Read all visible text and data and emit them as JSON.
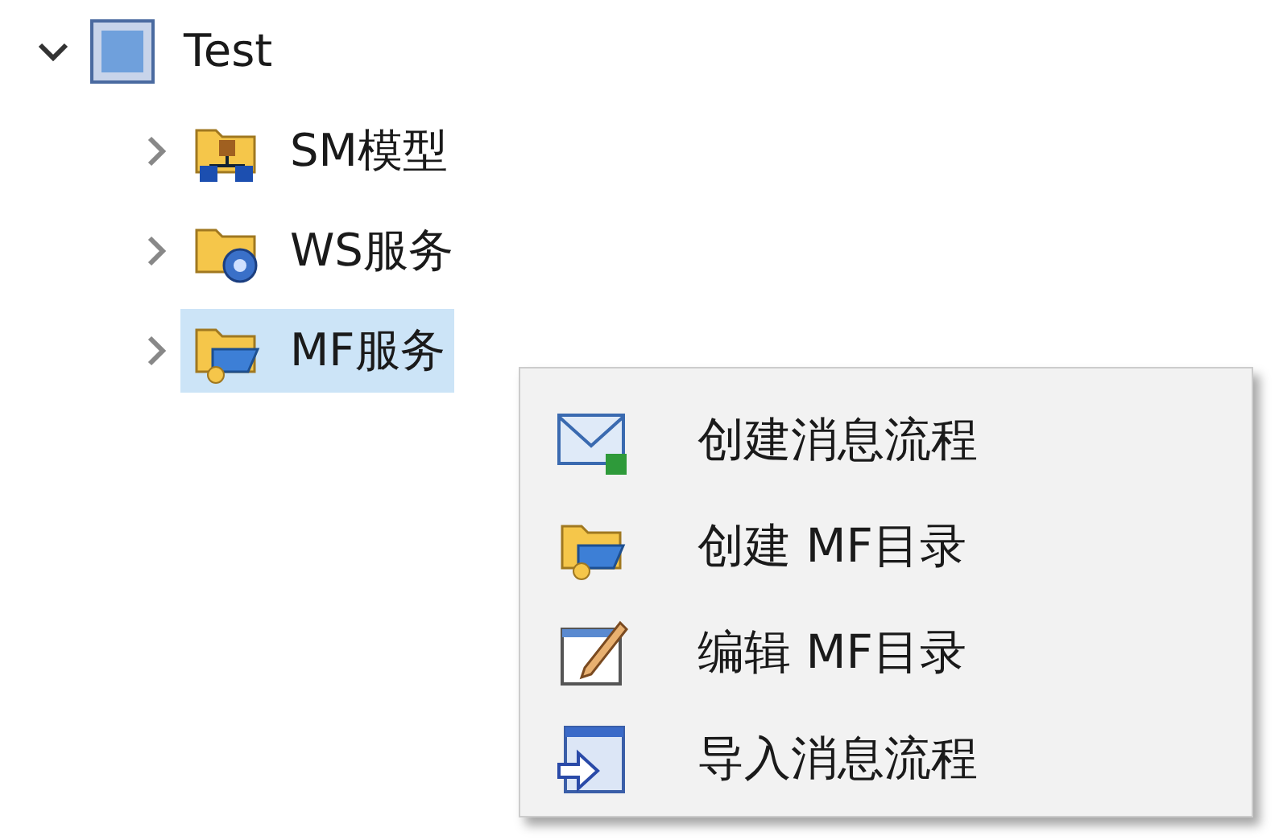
{
  "tree": {
    "label": "Test",
    "expanded": true,
    "selected": false,
    "children": [
      {
        "label": "SM模型",
        "expanded": false,
        "selected": false
      },
      {
        "label": "WS服务",
        "expanded": false,
        "selected": false
      },
      {
        "label": "MF服务",
        "expanded": false,
        "selected": true
      }
    ]
  },
  "context_menu": {
    "items": [
      {
        "label": "创建消息流程"
      },
      {
        "label": "创建 MF目录"
      },
      {
        "label": "编辑 MF目录"
      },
      {
        "label": "导入消息流程"
      }
    ]
  }
}
